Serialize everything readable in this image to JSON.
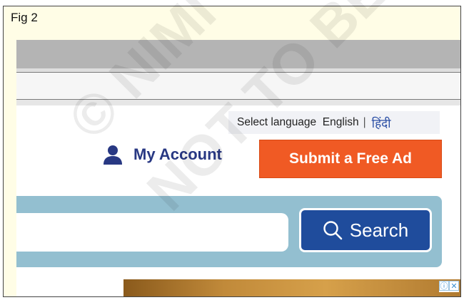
{
  "figure": {
    "label": "Fig 2"
  },
  "language_bar": {
    "prompt": "Select language",
    "option_english": "English",
    "separator": "|",
    "option_hindi": "हिंदी"
  },
  "account": {
    "label": "My Account",
    "icon": "user-icon"
  },
  "actions": {
    "submit_ad_label": "Submit a Free Ad"
  },
  "search": {
    "value": "",
    "button_label": "Search",
    "icon": "magnifier-icon"
  },
  "ad_banner": {
    "info_icon": "ⓘ",
    "close_icon": "✕"
  },
  "watermark": {
    "text": "© NIMI NOT TO BE REPUBLISHED"
  },
  "colors": {
    "brand_blue": "#283883",
    "search_button": "#1f4c9c",
    "submit_orange": "#f05a24",
    "search_band": "#93bfd0",
    "figure_background": "#fffde6"
  }
}
